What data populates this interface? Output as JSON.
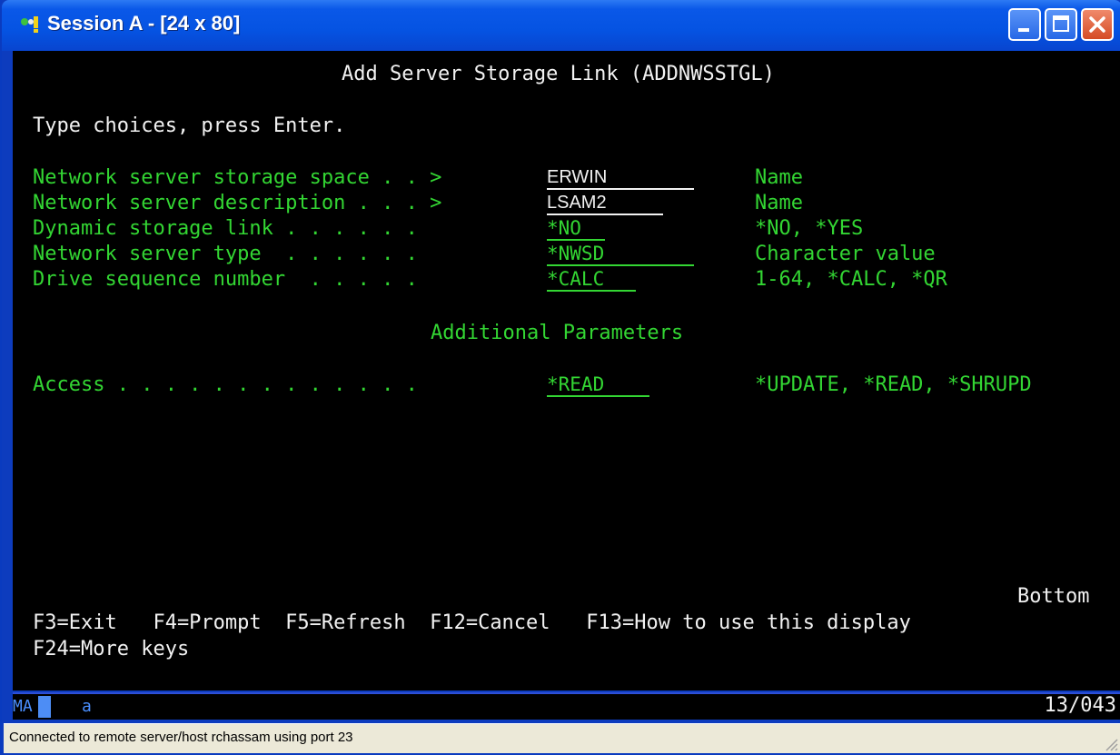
{
  "window": {
    "title": "Session A - [24 x 80]",
    "icon": "session-icon",
    "controls": [
      "minimize-icon",
      "maximize-icon",
      "close-icon"
    ]
  },
  "screen": {
    "heading": "Add Server Storage Link (ADDNWSSTGL)",
    "instruction": "Type choices, press Enter.",
    "fields": [
      {
        "label": "Network server storage space . . >",
        "value": "ERWIN",
        "hint": "Name"
      },
      {
        "label": "Network server description . . . >",
        "value": "LSAM2",
        "hint": "Name"
      },
      {
        "label": "Dynamic storage link . . . . . .",
        "value": "*NO",
        "hint": "*NO, *YES"
      },
      {
        "label": "Network server type  . . . . . .",
        "value": "*NWSD",
        "hint": "Character value"
      },
      {
        "label": "Drive sequence number  . . . . .",
        "value": "*CALC",
        "hint": "1-64, *CALC, *QR"
      }
    ],
    "section_heading": "Additional Parameters",
    "additional_fields": [
      {
        "label": "Access . . . . . . . . . . . . .",
        "value": "*READ",
        "hint": "*UPDATE, *READ, *SHRUPD"
      }
    ],
    "more_indicator": "Bottom",
    "function_keys_line1": "F3=Exit   F4=Prompt  F5=Refresh  F12=Cancel   F13=How to use this display",
    "function_keys_line2": "F24=More keys"
  },
  "oia": {
    "mode": "MA",
    "indicator": "a",
    "cursor_position": "13/043"
  },
  "statusbar": {
    "message": "Connected to remote server/host rchassam using port 23"
  },
  "colors": {
    "field_text": "#33d633",
    "input_text": "#f2f2f2",
    "background": "#000000",
    "titlebar": "#0553e2"
  }
}
